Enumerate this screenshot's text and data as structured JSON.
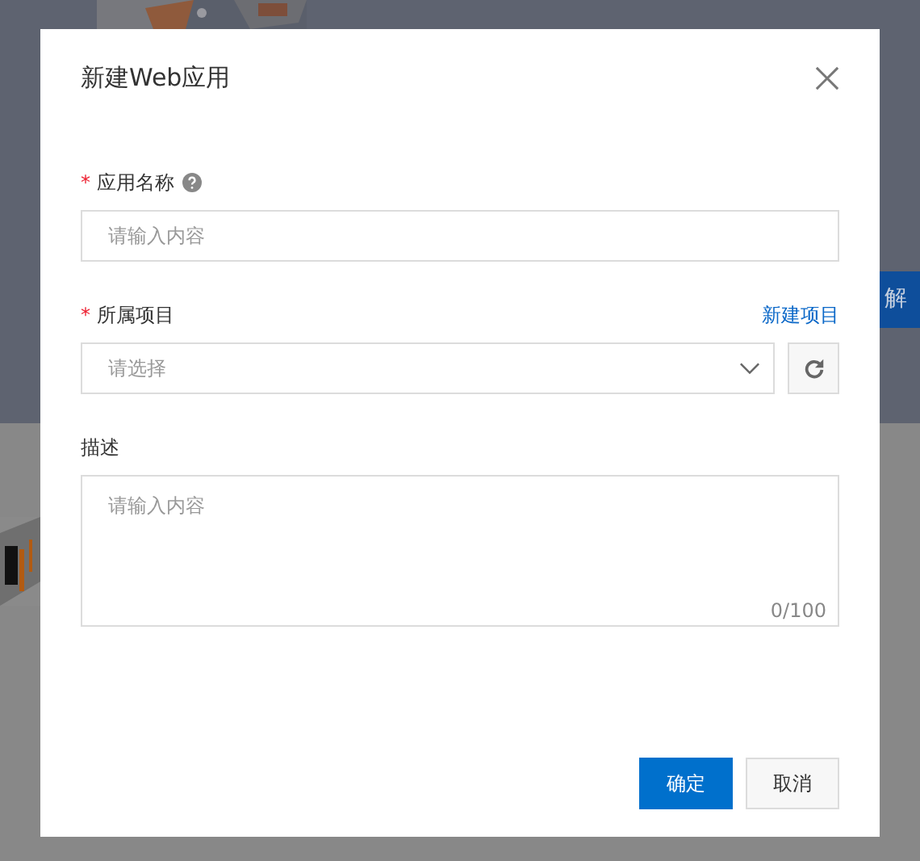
{
  "background": {
    "header_button": "解"
  },
  "dialog": {
    "title": "新建Web应用",
    "fields": [
      {
        "kind": "input",
        "label": "应用名称",
        "required_mark": "*",
        "help": true,
        "placeholder": "请输入内容"
      },
      {
        "kind": "select",
        "label": "所属项目",
        "required_mark": "*",
        "link": "新建项目",
        "placeholder": "请选择"
      },
      {
        "kind": "textarea",
        "label": "描述",
        "placeholder": "请输入内容",
        "counter": "0/100"
      }
    ],
    "buttons": [
      {
        "label": "确定",
        "kind": "primary"
      },
      {
        "label": "取消",
        "kind": "secondary"
      }
    ]
  }
}
